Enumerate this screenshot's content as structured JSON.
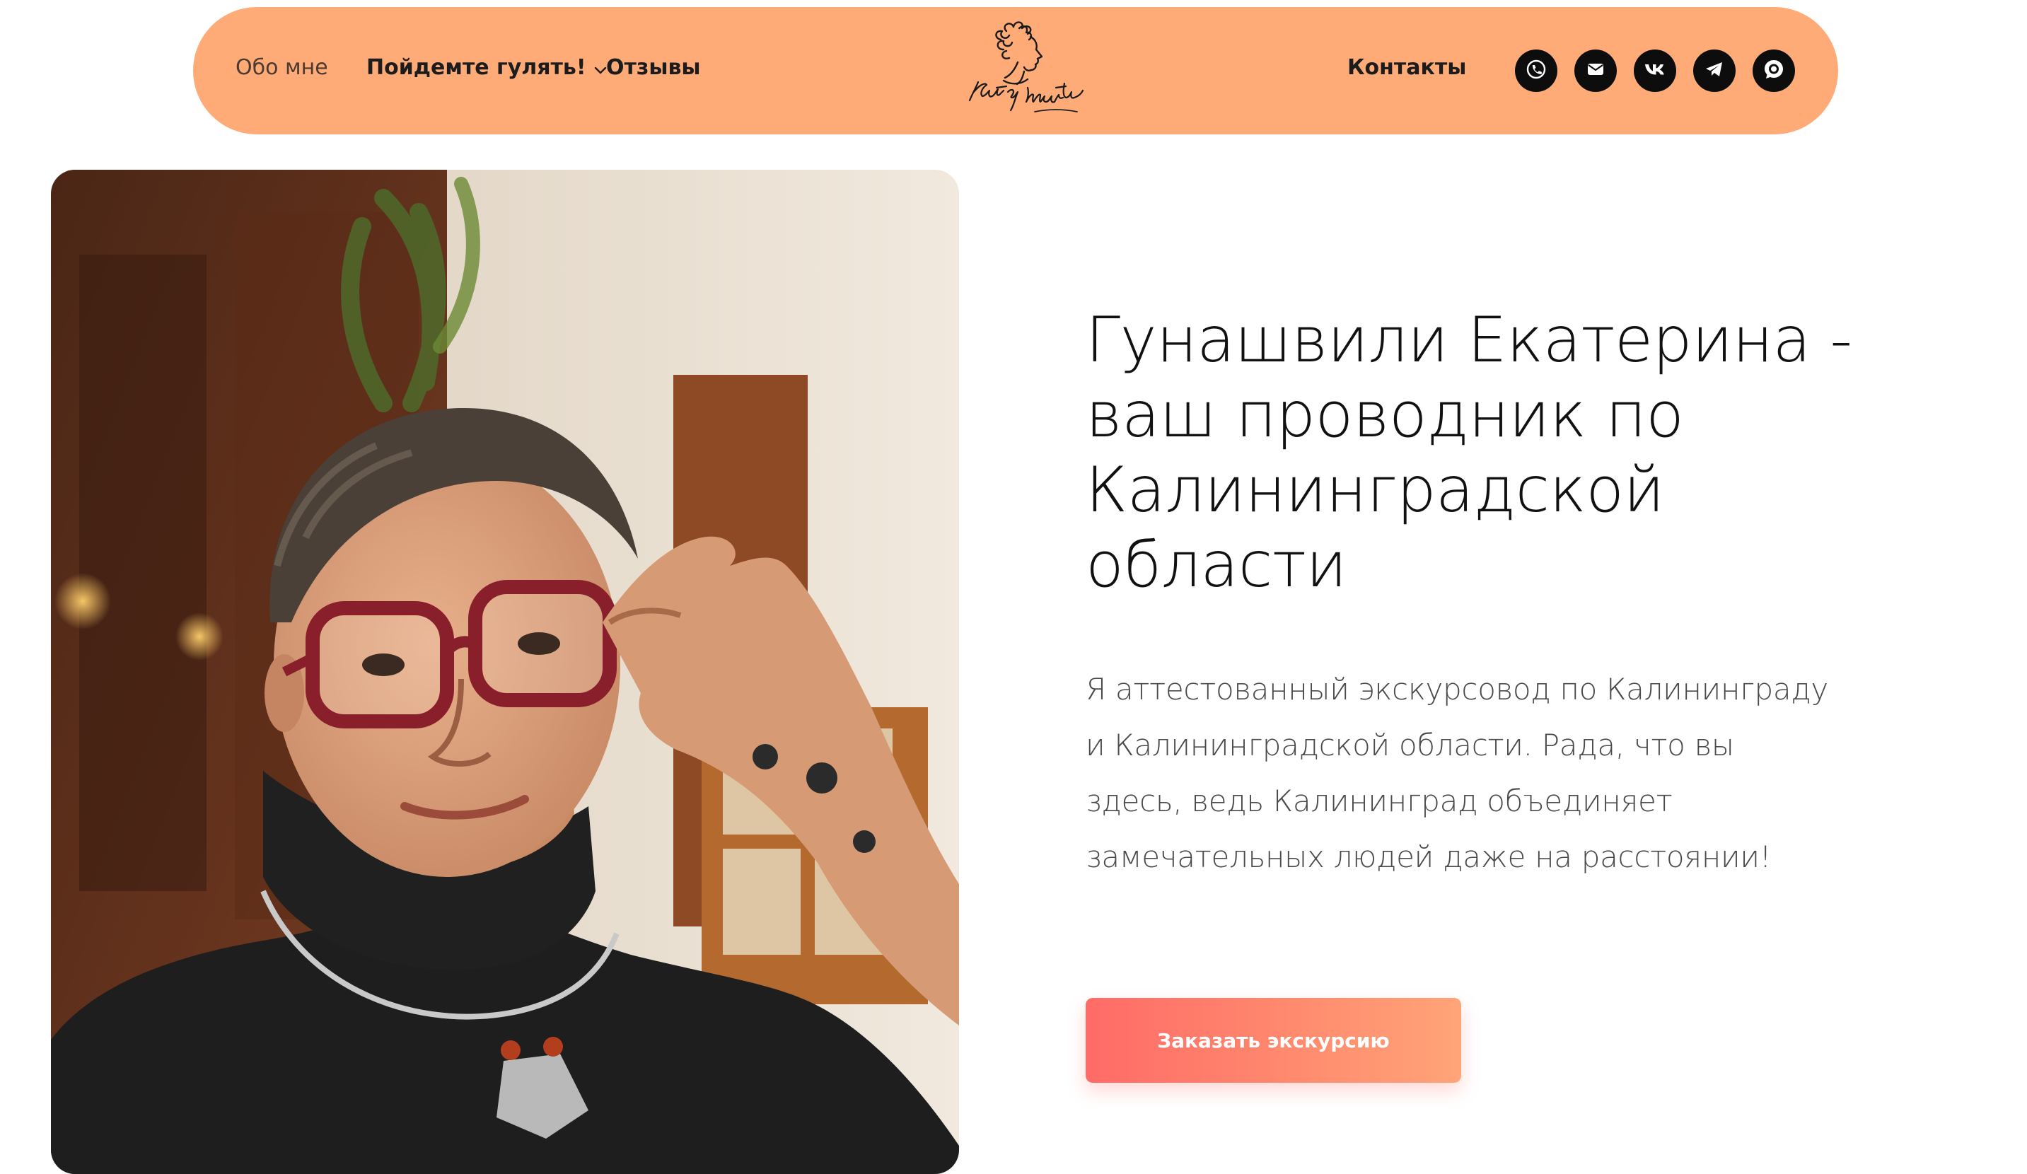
{
  "header": {
    "nav": {
      "about": "Обо мне",
      "walks": "Пойдемте гулять!",
      "reviews": "Отзывы",
      "contacts": "Контакты"
    },
    "logo_text": "Катя Марти",
    "social_icons": [
      "phone-icon",
      "mail-icon",
      "vk-icon",
      "telegram-icon",
      "max-messenger-icon"
    ]
  },
  "hero": {
    "title": "Гунашвили Екатерина - ваш проводник по Калининградской области",
    "intro": "Я аттестованный экскурсовод по Калининграду и Калининградской области. Рада, что вы здесь, ведь Калининград объединяет замечательных людей даже на расстоянии!",
    "cta": "Заказать экскурсию"
  },
  "colors": {
    "header_bg": "#ffab78",
    "cta_gradient_start": "#ff6b67",
    "cta_gradient_end": "#ffa478",
    "icon_circle": "#0d0d0d"
  }
}
